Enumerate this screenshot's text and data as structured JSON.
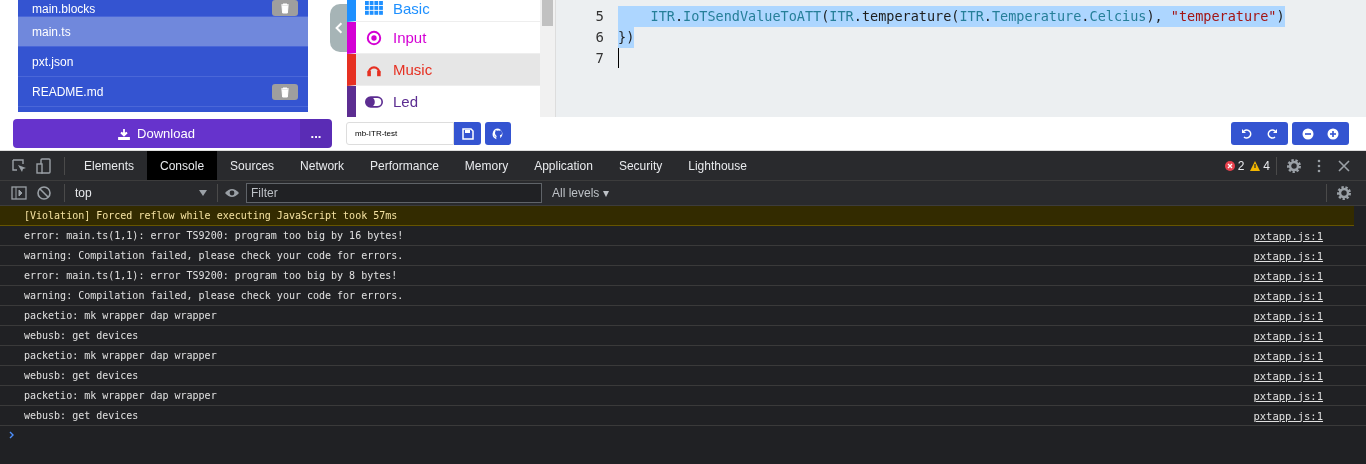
{
  "files": [
    {
      "name": "main.blocks",
      "selected": false,
      "deletable": true
    },
    {
      "name": "main.ts",
      "selected": true,
      "deletable": false
    },
    {
      "name": "pxt.json",
      "selected": false,
      "deletable": false
    },
    {
      "name": "README.md",
      "selected": false,
      "deletable": true
    }
  ],
  "toolbox": [
    {
      "label": "Basic",
      "color": "#1e90ff",
      "selected": false
    },
    {
      "label": "Input",
      "color": "#d400d4",
      "selected": false
    },
    {
      "label": "Music",
      "color": "#e63022",
      "selected": true
    },
    {
      "label": "Led",
      "color": "#5c2d91",
      "selected": false
    }
  ],
  "code": [
    {
      "number": "5",
      "selected": true,
      "segments": [
        {
          "kind": "ns",
          "text": "    ITR"
        },
        {
          "kind": "plain",
          "text": "."
        },
        {
          "kind": "member",
          "text": "IoTSendValueToATT"
        },
        {
          "kind": "plain",
          "text": "("
        },
        {
          "kind": "ns",
          "text": "ITR"
        },
        {
          "kind": "plain",
          "text": ".temperature("
        },
        {
          "kind": "ns",
          "text": "ITR"
        },
        {
          "kind": "plain",
          "text": "."
        },
        {
          "kind": "member",
          "text": "Temperature"
        },
        {
          "kind": "plain",
          "text": "."
        },
        {
          "kind": "member",
          "text": "Celcius"
        },
        {
          "kind": "plain",
          "text": "), "
        },
        {
          "kind": "string",
          "text": "\"temperature\""
        },
        {
          "kind": "plain",
          "text": ")"
        }
      ]
    },
    {
      "number": "6",
      "selected": true,
      "segments": [
        {
          "kind": "plain",
          "text": "})"
        }
      ]
    },
    {
      "number": "7",
      "cursor": true
    }
  ],
  "download": {
    "label": "Download",
    "more": "..."
  },
  "project_name": {
    "value": "mb-ITR-test"
  },
  "devtools": {
    "tabs": [
      {
        "label": "Elements",
        "selected": false
      },
      {
        "label": "Console",
        "selected": true
      },
      {
        "label": "Sources",
        "selected": false
      },
      {
        "label": "Network",
        "selected": false
      },
      {
        "label": "Performance",
        "selected": false
      },
      {
        "label": "Memory",
        "selected": false
      },
      {
        "label": "Application",
        "selected": false
      },
      {
        "label": "Security",
        "selected": false
      },
      {
        "label": "Lighthouse",
        "selected": false
      }
    ],
    "error_count": "2",
    "warning_count": "4",
    "context": "top",
    "filter": {
      "placeholder": "Filter"
    },
    "levels": "All levels ▾",
    "messages": [
      {
        "kind": "violation",
        "text": "[Violation] Forced reflow while executing JavaScript took 57ms"
      },
      {
        "kind": "log",
        "text": "error: main.ts(1,1): error TS9200: program too big by 16 bytes!",
        "source": "pxtapp.js:1"
      },
      {
        "kind": "log",
        "text": "warning: Compilation failed, please check your code for errors.",
        "source": "pxtapp.js:1"
      },
      {
        "kind": "log",
        "text": "error: main.ts(1,1): error TS9200: program too big by 8 bytes!",
        "source": "pxtapp.js:1"
      },
      {
        "kind": "log",
        "text": "warning: Compilation failed, please check your code for errors.",
        "source": "pxtapp.js:1"
      },
      {
        "kind": "log",
        "text": "packetio: mk wrapper dap wrapper",
        "source": "pxtapp.js:1"
      },
      {
        "kind": "log",
        "text": "webusb: get devices",
        "source": "pxtapp.js:1"
      },
      {
        "kind": "log",
        "text": "packetio: mk wrapper dap wrapper",
        "source": "pxtapp.js:1"
      },
      {
        "kind": "log",
        "text": "webusb: get devices",
        "source": "pxtapp.js:1"
      },
      {
        "kind": "log",
        "text": "packetio: mk wrapper dap wrapper",
        "source": "pxtapp.js:1"
      },
      {
        "kind": "log",
        "text": "webusb: get devices",
        "source": "pxtapp.js:1"
      }
    ]
  }
}
